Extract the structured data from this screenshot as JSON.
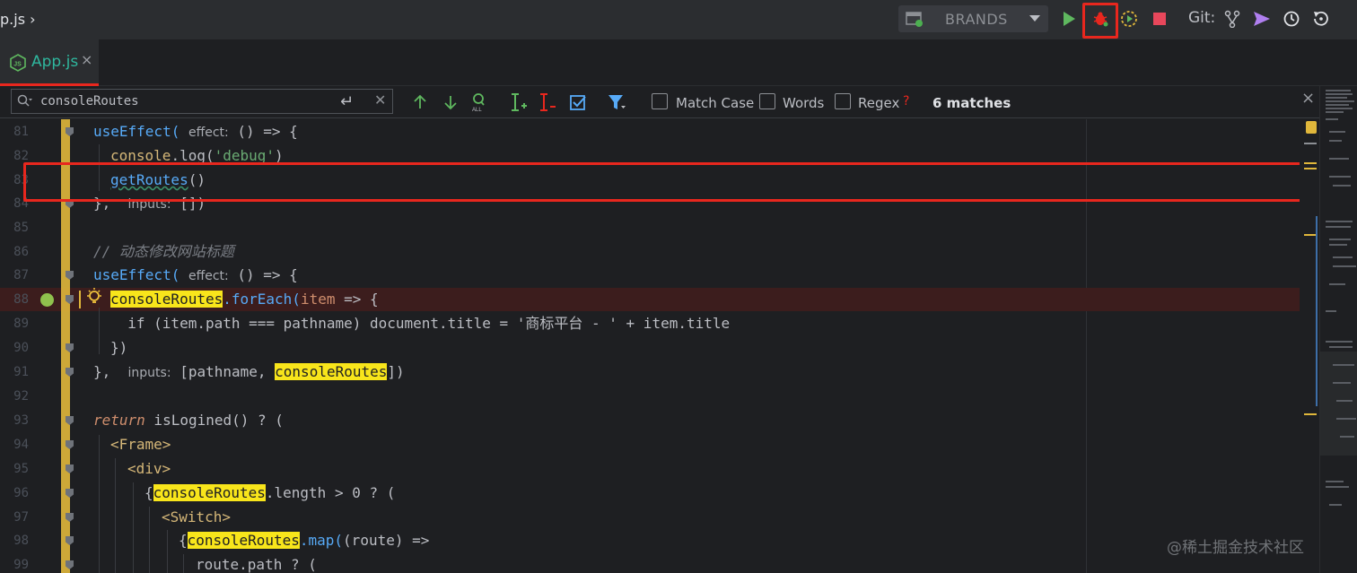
{
  "breadcrumb": "p.js",
  "run_config": {
    "label": "BRANDS"
  },
  "git_label": "Git:",
  "tab": {
    "label": "App.js"
  },
  "find": {
    "query": "consoleRoutes",
    "match_case_label": "Match Case",
    "words_label": "Words",
    "regex_label": "Regex",
    "regex_help": "?",
    "match_count": "6 matches"
  },
  "lines": [
    {
      "n": "81"
    },
    {
      "n": "82"
    },
    {
      "n": "83"
    },
    {
      "n": "84"
    },
    {
      "n": "85"
    },
    {
      "n": "86"
    },
    {
      "n": "87"
    },
    {
      "n": "88"
    },
    {
      "n": "89"
    },
    {
      "n": "90"
    },
    {
      "n": "91"
    },
    {
      "n": "92"
    },
    {
      "n": "93"
    },
    {
      "n": "94"
    },
    {
      "n": "95"
    },
    {
      "n": "96"
    },
    {
      "n": "97"
    },
    {
      "n": "98"
    },
    {
      "n": "99"
    }
  ],
  "code": {
    "l81_fn": "useEffect(",
    "l81_hint": "effect:",
    "l81_rest": " () => {",
    "l82_obj": "console",
    "l82_mid": ".log(",
    "l82_str": "'debug'",
    "l82_end": ")",
    "l83_fn": "getRoutes",
    "l83_end": "()",
    "l84_start": "},",
    "l84_hint": "inputs:",
    "l84_rest": " [])",
    "l86_comment": "// 动态修改网站标题",
    "l87_fn": "useEffect(",
    "l87_hint": "effect:",
    "l87_rest": " () => {",
    "l88_mark": "consoleRoutes",
    "l88_method": ".forEach(",
    "l88_param": "item",
    "l88_rest": " => {",
    "l89_text": "  if (item.path === pathname) document.title = '商标平台 - ' + item.title",
    "l90_text": "})",
    "l91_start": "},",
    "l91_hint": "inputs:",
    "l91_open": " [pathname, ",
    "l91_mark": "consoleRoutes",
    "l91_close": "])",
    "l93_kw": "return",
    "l93_fn": " isLogined",
    "l93_rest": "() ? (",
    "l94_tag": "<Frame>",
    "l95_tag": "<div>",
    "l96_open": "{",
    "l96_mark": "consoleRoutes",
    "l96_rest": ".length > 0 ? (",
    "l97_tag": "<Switch>",
    "l98_open": "{",
    "l98_mark": "consoleRoutes",
    "l98_method": ".map(",
    "l98_rest": "(route) =>",
    "l99_text": "route.path ? ("
  },
  "watermark": "@稀土掘金技术社区",
  "colors": {
    "breakpoint_highlight": "#e8271e",
    "search_match": "#f8e51b",
    "gutter_bar": "#e0b73b"
  }
}
